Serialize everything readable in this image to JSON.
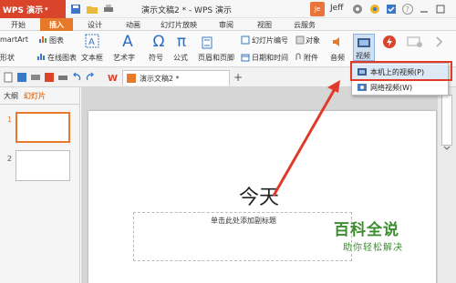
{
  "app": {
    "brand": "WPS 演示",
    "doc_title": "演示文稿2 * - WPS 演示",
    "user_initial": "Je",
    "user_name": "Jeff"
  },
  "tabs": [
    {
      "label": "开始"
    },
    {
      "label": "插入",
      "active": true
    },
    {
      "label": "设计"
    },
    {
      "label": "动画"
    },
    {
      "label": "幻灯片放映"
    },
    {
      "label": "审阅"
    },
    {
      "label": "视图"
    },
    {
      "label": "云服务"
    }
  ],
  "ribbon": {
    "smartart": "martArt",
    "chart": "图表",
    "shape": "形状",
    "online_chart": "在线图表",
    "textbox": "文本框",
    "arttext": "艺术字",
    "symbol": "符号",
    "formula": "公式",
    "slide_number": "幻灯片编号",
    "object": "对象",
    "header_footer": "页眉和页脚",
    "datetime": "日期和时间",
    "attachment": "附件",
    "audio": "音频",
    "video": "视频"
  },
  "doc_tab": {
    "label": "演示文稿2 *"
  },
  "left_pane": {
    "tab_outline": "大纲",
    "tab_slides": "幻灯片",
    "slides": [
      "1",
      "2"
    ]
  },
  "slide": {
    "title": "今天",
    "subtitle_placeholder": "单击此处添加副标题"
  },
  "dropdown": {
    "items": [
      {
        "label": "本机上的视频(P)",
        "icon": "film-icon"
      },
      {
        "label": "网络视频(W)",
        "icon": "web-video-icon"
      }
    ]
  },
  "watermark": {
    "main": "百科全说",
    "sub": "助你轻松解决"
  },
  "colors": {
    "brand": "#d9442a",
    "accent_tab": "#e67a2a",
    "highlight": "#e23a2a",
    "watermark": "#3b8e2e"
  }
}
